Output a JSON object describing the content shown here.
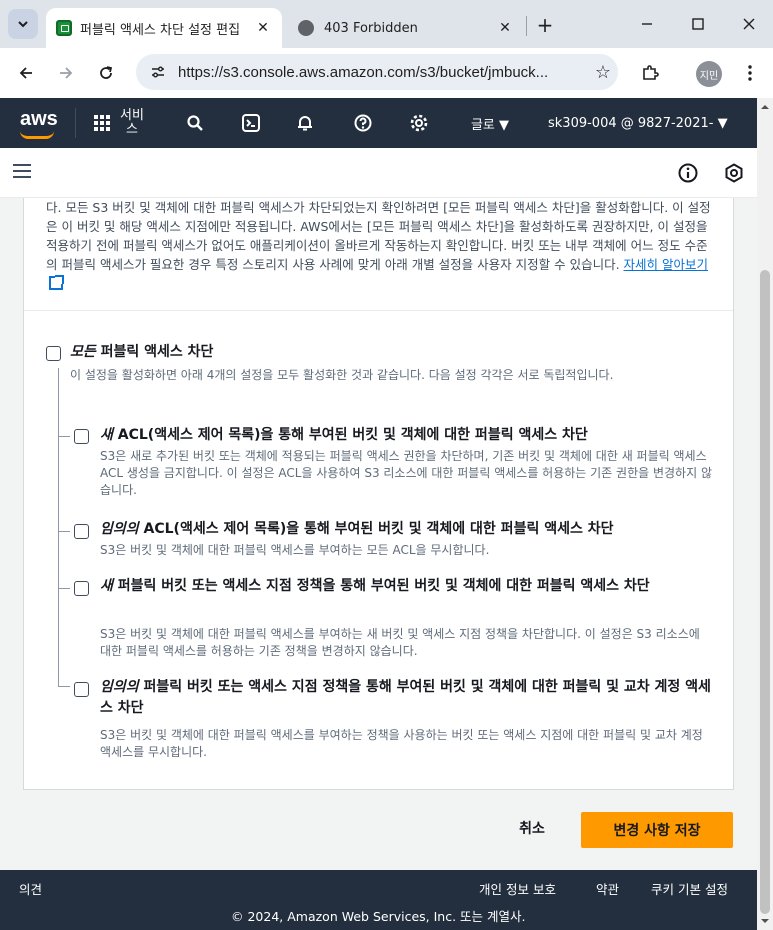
{
  "browser": {
    "tabs": [
      {
        "title": "퍼블릭 액세스 차단 설정 편집",
        "active": true
      },
      {
        "title": "403 Forbidden",
        "active": false
      }
    ],
    "url": "https://s3.console.aws.amazon.com/s3/bucket/jmbuck...",
    "profile_label": "지민"
  },
  "aws_header": {
    "logo": "aws",
    "services_label": "서비스",
    "region_label": "글로 ▼",
    "account_label": "sk309-004 @ 9827-2021- ▼"
  },
  "intro": {
    "text": "다. 모든 S3 버킷 및 객체에 대한 퍼블릭 액세스가 차단되었는지 확인하려면 [모든 퍼블릭 액세스 차단]을 활성화합니다. 이 설정은 이 버킷 및 해당 액세스 지점에만 적용됩니다. AWS에서는 [모든 퍼블릭 액세스 차단]을 활성화하도록 권장하지만, 이 설정을 적용하기 전에 퍼블릭 액세스가 없어도 애플리케이션이 올바르게 작동하는지 확인합니다. 버킷 또는 내부 객체에 어느 정도 수준의 퍼블릭 액세스가 필요한 경우 특정 스토리지 사용 사례에 맞게 아래 개별 설정을 사용자 지정할 수 있습니다.",
    "learn_more": "자세히 알아보기"
  },
  "block_all": {
    "title_em": "모든",
    "title_rest": " 퍼블릭 액세스 차단",
    "desc": "이 설정을 활성화하면 아래 4개의 설정을 모두 활성화한 것과 같습니다. 다음 설정 각각은 서로 독립적입니다."
  },
  "options": [
    {
      "title_em": "새",
      "title_rest": " ACL(액세스 제어 목록)을 통해 부여된 버킷 및 객체에 대한 퍼블릭 액세스 차단",
      "desc": "S3은 새로 추가된 버킷 또는 객체에 적용되는 퍼블릭 액세스 권한을 차단하며, 기존 버킷 및 객체에 대한 새 퍼블릭 액세스 ACL 생성을 금지합니다. 이 설정은 ACL을 사용하여 S3 리소스에 대한 퍼블릭 액세스를 허용하는 기존 권한을 변경하지 않습니다."
    },
    {
      "title_em": "임의의",
      "title_rest": " ACL(액세스 제어 목록)을 통해 부여된 버킷 및 객체에 대한 퍼블릭 액세스 차단",
      "desc": "S3은 버킷 및 객체에 대한 퍼블릭 액세스를 부여하는 모든 ACL을 무시합니다."
    },
    {
      "title_em": "새",
      "title_rest": " 퍼블릭 버킷 또는 액세스 지점 정책을 통해 부여된 버킷 및 객체에 대한 퍼블릭 액세스 차단",
      "desc": "S3은 버킷 및 객체에 대한 퍼블릭 액세스를 부여하는 새 버킷 및 액세스 지점 정책을 차단합니다. 이 설정은 S3 리소스에 대한 퍼블릭 액세스를 허용하는 기존 정책을 변경하지 않습니다."
    },
    {
      "title_em": "임의의",
      "title_rest": " 퍼블릭 버킷 또는 액세스 지점 정책을 통해 부여된 버킷 및 객체에 대한 퍼블릭 및 교차 계정 액세스 차단",
      "desc": "S3은 버킷 및 객체에 대한 퍼블릭 액세스를 부여하는 정책을 사용하는 버킷 또는 액세스 지점에 대한 퍼블릭 및 교차 계정 액세스를 무시합니다."
    }
  ],
  "actions": {
    "cancel": "취소",
    "save": "변경 사항 저장"
  },
  "footer": {
    "feedback": "의견",
    "privacy": "개인 정보 보호",
    "terms": "약관",
    "cookies": "쿠키 기본 설정",
    "copyright": "© 2024, Amazon Web Services, Inc. 또는 계열사."
  }
}
